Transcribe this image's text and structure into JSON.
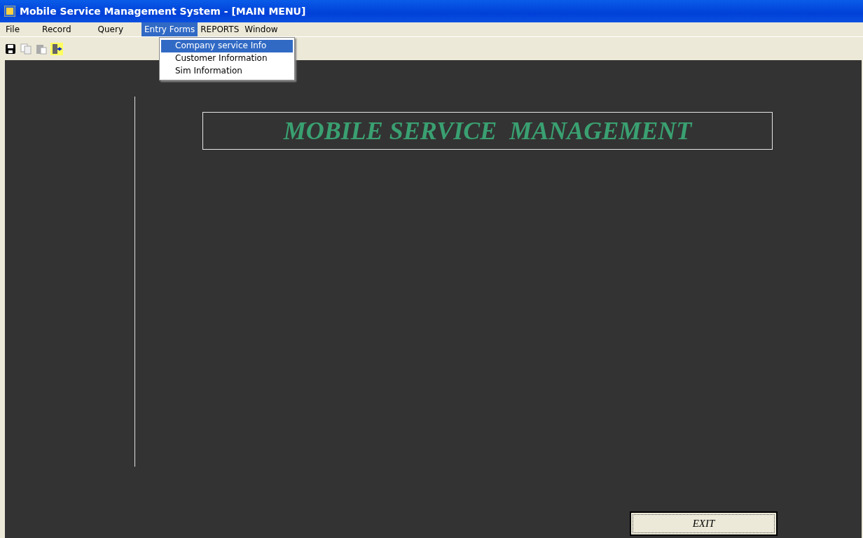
{
  "window": {
    "title": "Mobile Service Management System - [MAIN MENU]"
  },
  "menu": [
    {
      "label": "File",
      "selected": false
    },
    {
      "label": "Record",
      "selected": false
    },
    {
      "label": "Query",
      "selected": false
    },
    {
      "label": "Entry Forms",
      "selected": true
    },
    {
      "label": "REPORTS",
      "selected": false
    },
    {
      "label": "Window",
      "selected": false
    }
  ],
  "dropdown": [
    {
      "label": "Company service Info",
      "selected": true
    },
    {
      "label": "Customer Information",
      "selected": false
    },
    {
      "label": "Sim Information",
      "selected": false
    }
  ],
  "toolbar": [
    {
      "kind": "save",
      "disabled": false
    },
    {
      "kind": "copy",
      "disabled": true
    },
    {
      "kind": "paste",
      "disabled": true
    },
    {
      "kind": "exit",
      "disabled": false
    }
  ],
  "banner": {
    "title": "MOBILE SERVICE  MANAGEMENT"
  },
  "exit_button": {
    "label": "EXIT"
  }
}
